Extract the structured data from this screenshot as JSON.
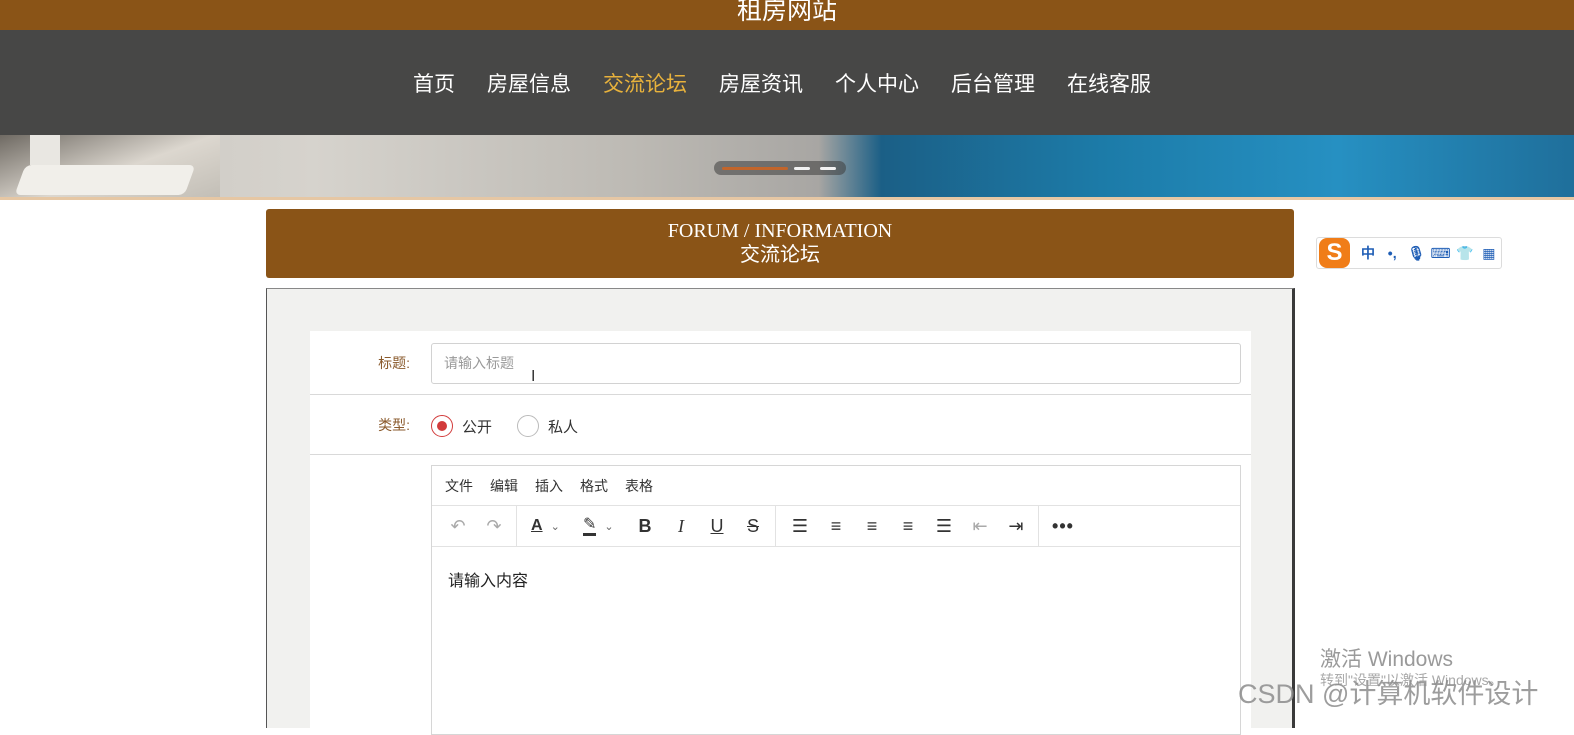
{
  "site": {
    "title": "租房网站"
  },
  "nav": {
    "items": [
      "首页",
      "房屋信息",
      "交流论坛",
      "房屋资讯",
      "个人中心",
      "后台管理",
      "在线客服"
    ],
    "active_index": 2
  },
  "section": {
    "title_en": "FORUM / INFORMATION",
    "title_cn": "交流论坛"
  },
  "form": {
    "title_label": "标题:",
    "title_placeholder": "请输入标题",
    "type_label": "类型:",
    "type_options": [
      "公开",
      "私人"
    ],
    "type_selected": "公开"
  },
  "editor": {
    "menu": [
      "文件",
      "编辑",
      "插入",
      "格式",
      "表格"
    ],
    "placeholder": "请输入内容"
  },
  "ime": {
    "logo": "S",
    "mode": "中",
    "punct": "•,",
    "icons": [
      "microphone-icon",
      "keyboard-icon",
      "skin-icon",
      "grid-icon"
    ]
  },
  "overlays": {
    "activate_title": "激活 Windows",
    "activate_sub": "转到\"设置\"以激活 Windows。",
    "csdn": "CSDN @计算机软件设计"
  },
  "colors": {
    "brand": "#8a5417",
    "nav_bg": "#474746",
    "nav_active": "#e8b23c",
    "radio_active": "#d23b3b"
  }
}
